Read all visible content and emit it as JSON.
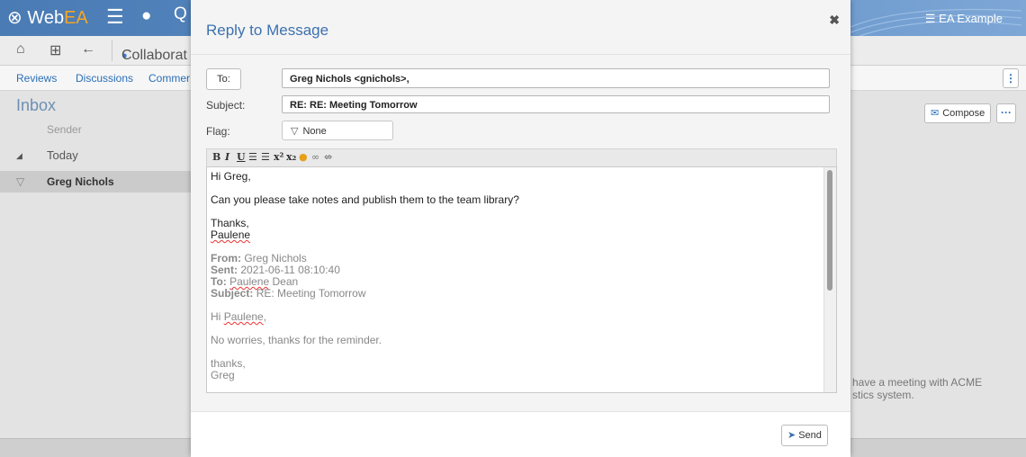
{
  "app": {
    "brand_prefix": "Web",
    "brand_suffix": "EA",
    "model_name": "EA Example",
    "collab_tab": "Collaborat",
    "nav_links": [
      "Reviews",
      "Discussions",
      "Commer"
    ],
    "inbox_title": "Inbox",
    "sender_column": "Sender",
    "group_today": "Today",
    "row_sender": "Greg Nichols",
    "compose_label": "Compose",
    "preview_line1": "have a meeting with ACME",
    "preview_line2": "stics system."
  },
  "dialog": {
    "title": "Reply to Message",
    "to_button": "To:",
    "to_value": "Greg Nichols <gnichols>,",
    "subject_label": "Subject:",
    "subject_value": "RE: RE: Meeting Tomorrow",
    "flag_label": "Flag:",
    "flag_value": "None",
    "send_label": "Send"
  },
  "editor_toolbar": [
    "B",
    "I",
    "U",
    "ordered-list-icon",
    "bullet-list-icon",
    "superscript-icon",
    "subscript-icon",
    "color-icon",
    "link-icon",
    "unlink-icon"
  ],
  "body": {
    "greeting": "Hi Greg,",
    "line1": "Can you please take notes and publish them to the team library?",
    "signoff": "Thanks,",
    "signature": "Paulene",
    "quoted": {
      "from_label": "From:",
      "from_value": "Greg Nichols",
      "sent_label": "Sent:",
      "sent_value": "2021-06-11 08:10:40",
      "to_label": "To:",
      "to_value_first": "Paulene",
      "to_value_last": "Dean",
      "subject_label": "Subject:",
      "subject_value": "RE: Meeting Tomorrow",
      "greeting_prefix": "Hi",
      "greeting_name": "Paulene",
      "greeting_suffix": ",",
      "line1": "No worries, thanks for the reminder.",
      "closing": "thanks,",
      "closing_name": "Greg"
    }
  },
  "colors": {
    "accent": "#3c71ae",
    "header_blue": "#4a7bb4",
    "brand_orange": "#f6a623"
  }
}
